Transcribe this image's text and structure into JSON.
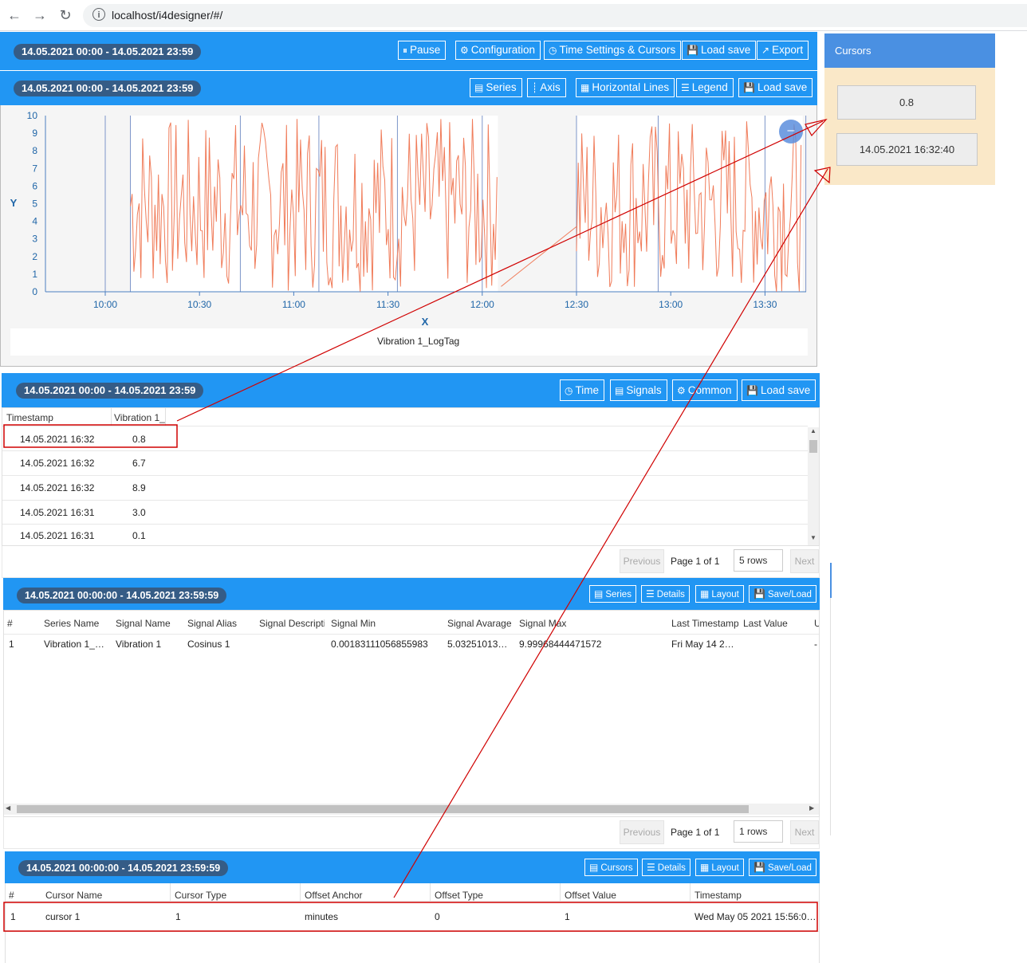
{
  "browser": {
    "url": "localhost/i4designer/#/"
  },
  "panel1": {
    "range": "14.05.2021 00:00 - 14.05.2021 23:59",
    "buttons": [
      "Pause",
      "Configuration",
      "Time Settings & Cursors",
      "Load save",
      "Export"
    ]
  },
  "chart_panel": {
    "range": "14.05.2021 00:00 - 14.05.2021 23:59",
    "buttons": [
      "Series",
      "Axis",
      "Horizontal Lines",
      "Legend",
      "Load save"
    ]
  },
  "chart_data": {
    "type": "line",
    "xlabel": "X",
    "ylabel": "Y",
    "ylim": [
      0,
      10
    ],
    "yticks": [
      "0",
      "1",
      "2",
      "3",
      "4",
      "5",
      "6",
      "7",
      "8",
      "9",
      "10"
    ],
    "xticks": [
      "10:00",
      "10:30",
      "11:00",
      "11:30",
      "12:00",
      "12:30",
      "13:00",
      "13:30"
    ],
    "series": [
      {
        "name": "Vibration 1_LogTag",
        "color": "#f07c5a",
        "segments": [
          {
            "from": "10:08",
            "to": "12:05"
          },
          {
            "from": "12:30",
            "to": "13:42"
          }
        ],
        "gap_line": {
          "from": [
            "12:06",
            0.3
          ],
          "to": [
            "12:30",
            3.7
          ]
        }
      }
    ],
    "vertical_markers": [
      "10:00",
      "10:08",
      "10:43",
      "11:08",
      "11:33",
      "12:00",
      "12:30",
      "12:56",
      "13:30",
      "13:43"
    ],
    "legend": "Vibration 1_LogTag"
  },
  "log_table": {
    "range": "14.05.2021 00:00 - 14.05.2021 23:59",
    "buttons": [
      "Time",
      "Signals",
      "Common",
      "Load save"
    ],
    "columns": [
      "Timestamp",
      "Vibration 1_"
    ],
    "rows": [
      [
        "14.05.2021 16:32",
        "0.8"
      ],
      [
        "14.05.2021 16:32",
        "6.7"
      ],
      [
        "14.05.2021 16:32",
        "8.9"
      ],
      [
        "14.05.2021 16:31",
        "3.0"
      ],
      [
        "14.05.2021 16:31",
        "0.1"
      ]
    ],
    "pagination": {
      "previous": "Previous",
      "page": "Page 1 of 1",
      "rows": "5 rows",
      "next": "Next"
    }
  },
  "series_table": {
    "range": "14.05.2021 00:00:00 - 14.05.2021 23:59:59",
    "buttons": [
      "Series",
      "Details",
      "Layout",
      "Save/Load"
    ],
    "columns": [
      "#",
      "Series Name",
      "Signal Name",
      "Signal Alias",
      "Signal Descripti",
      "Signal Min",
      "Signal Avarage",
      "Signal Max",
      "Last Timestamp",
      "Last Value",
      "U"
    ],
    "rows": [
      [
        "1",
        "Vibration 1_…",
        "Vibration 1",
        "Cosinus 1",
        "",
        "0.00183111056855983",
        "5.03251013…",
        "9.99968444471572",
        "Fri May 14 2…",
        "",
        "-"
      ]
    ],
    "pagination": {
      "previous": "Previous",
      "page": "Page 1 of 1",
      "rows": "1 rows",
      "next": "Next"
    }
  },
  "cursor_table": {
    "range": "14.05.2021 00:00:00 - 14.05.2021 23:59:59",
    "buttons": [
      "Cursors",
      "Details",
      "Layout",
      "Save/Load"
    ],
    "columns": [
      "#",
      "Cursor Name",
      "Cursor Type",
      "Offset Anchor",
      "Offset Type",
      "Offset Value",
      "Timestamp"
    ],
    "rows": [
      [
        "1",
        "cursor 1",
        "1",
        "minutes",
        "0",
        "1",
        "Wed May 05 2021 15:56:0…"
      ]
    ]
  },
  "cursors_panel": {
    "title": "Cursors",
    "value": "0.8",
    "timestamp": "14.05.2021 16:32:40"
  },
  "colors": {
    "accent": "#2196f3",
    "pill": "#355c86",
    "series": "#f07c5a",
    "annotation": "#d00000",
    "cursors_bg": "#fae8c8"
  }
}
